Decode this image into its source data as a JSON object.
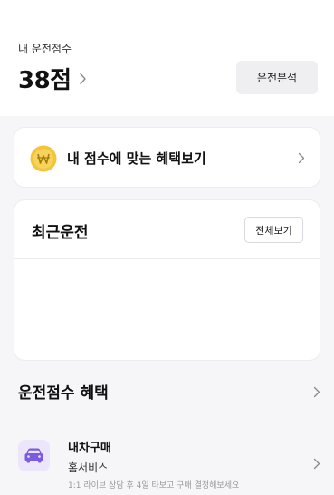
{
  "header": {
    "score_label": "내 운전점수",
    "score_value": "38점",
    "analysis_button": "운전분석"
  },
  "benefit_card": {
    "text": "내 점수에 맞는 혜택보기",
    "icon": "won-coin-icon"
  },
  "recent": {
    "title": "최근운전",
    "view_all_button": "전체보기"
  },
  "benefits_section": {
    "title": "운전점수 혜택",
    "items": [
      {
        "title": "내차구매",
        "subtitle": "홈서비스",
        "description": "1:1 라이브 상담 후 4일 타보고 구매 결정해보세요",
        "icon": "car-icon"
      }
    ]
  },
  "colors": {
    "coin": "#f2c53a",
    "car_icon": "#7b5ce0",
    "car_icon_bg": "#ece6fb"
  }
}
